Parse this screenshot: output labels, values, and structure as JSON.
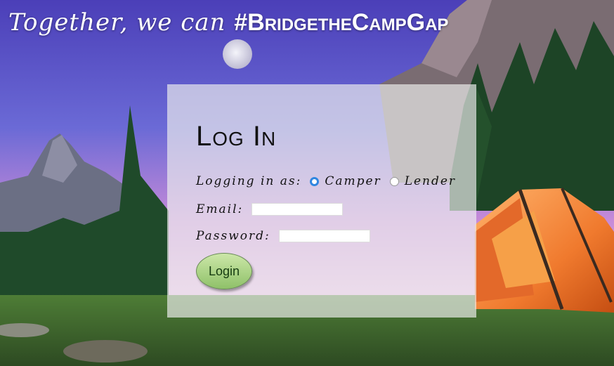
{
  "header": {
    "headline_text": "Together, we can",
    "hashtag": "#BridgetheCampGap"
  },
  "login": {
    "title": "Log In",
    "role_label": "Logging in as:",
    "roles": [
      {
        "label": "Camper",
        "selected": true
      },
      {
        "label": "Lender",
        "selected": false
      }
    ],
    "email_label": "Email:",
    "email_value": "",
    "password_label": "Password:",
    "password_value": "",
    "submit_label": "Login"
  },
  "colors": {
    "radio_selected": "#2f86e0",
    "button_green": "#a8d37f"
  }
}
